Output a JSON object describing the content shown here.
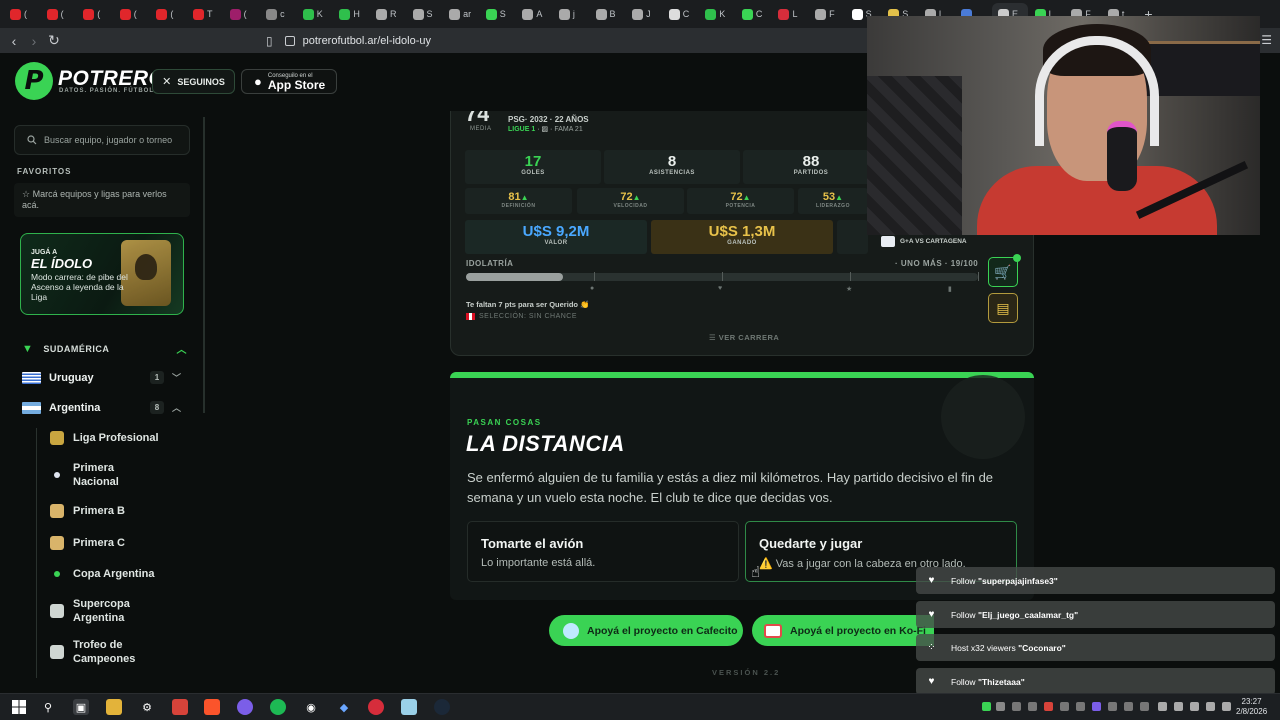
{
  "browser": {
    "tabs": [
      {
        "label": "(",
        "color": "#e0262b"
      },
      {
        "label": "(",
        "color": "#e0262b"
      },
      {
        "label": "(",
        "color": "#e0262b"
      },
      {
        "label": "(",
        "color": "#e0262b"
      },
      {
        "label": "(",
        "color": "#e0262b"
      },
      {
        "label": "T",
        "color": "#e0262b"
      },
      {
        "label": "(",
        "color": "#9e1e6a"
      },
      {
        "label": "c",
        "color": "#888888"
      },
      {
        "label": "K",
        "color": "#2fbf4c"
      },
      {
        "label": "H",
        "color": "#2fbf4c"
      },
      {
        "label": "R",
        "color": "#aaaaaa"
      },
      {
        "label": "S",
        "color": "#aaaaaa"
      },
      {
        "label": "ar",
        "color": "#aaaaaa"
      },
      {
        "label": "S",
        "color": "#3ad354"
      },
      {
        "label": "A",
        "color": "#aaaaaa"
      },
      {
        "label": "j",
        "color": "#aaaaaa"
      },
      {
        "label": "B",
        "color": "#aaaaaa"
      },
      {
        "label": "J",
        "color": "#aaaaaa"
      },
      {
        "label": "C",
        "color": "#dddddd"
      },
      {
        "label": "K",
        "color": "#2fbf4c"
      },
      {
        "label": "C",
        "color": "#3ad354"
      },
      {
        "label": "L",
        "color": "#d62d3b"
      },
      {
        "label": "F",
        "color": "#aaaaaa"
      },
      {
        "label": "S",
        "color": "#ffffff"
      },
      {
        "label": "S",
        "color": "#e3c14a"
      },
      {
        "label": "L",
        "color": "#aaaaaa"
      },
      {
        "label": "",
        "color": "#4a7bd8"
      },
      {
        "label": "E",
        "color": "#cccccc"
      },
      {
        "label": "L",
        "color": "#3ad354"
      },
      {
        "label": "F",
        "color": "#aaaaaa"
      },
      {
        "label": "t",
        "color": "#aaaaaa"
      }
    ],
    "new_tab": "+",
    "url": "potrerofutbol.ar/el-idolo-uy"
  },
  "header": {
    "brand": "POTRERO",
    "tagline": "DATOS. PASIÓN. FÚTBOL.",
    "follow_label": "SEGUINOS",
    "store_small": "Conseguilo en el",
    "store_big": "App Store"
  },
  "sidebar": {
    "search_placeholder": "Buscar equipo, jugador o torneo",
    "favorites_title": "FAVORITOS",
    "favorites_hint": "☆  Marcá equipos y ligas para verlos acá.",
    "promo": {
      "pre": "JUGÁ A",
      "title": "EL ÍDOLO",
      "desc": "Modo carrera: de pibe del Ascenso a leyenda de la Liga"
    },
    "region": "SUDAMÉRICA",
    "countries": [
      {
        "name": "Uruguay",
        "count": "1"
      },
      {
        "name": "Argentina",
        "count": "8"
      }
    ],
    "leagues": [
      {
        "name": "Liga Profesional",
        "color": "#c9a640"
      },
      {
        "name": "Primera Nacional",
        "color": "#dfe5f0"
      },
      {
        "name": "Primera B",
        "color": "#d9b46a"
      },
      {
        "name": "Primera C",
        "color": "#d9b46a"
      },
      {
        "name": "Copa Argentina",
        "color": "#3ad354"
      },
      {
        "name": "Supercopa Argentina",
        "color": "#cfd6d2"
      },
      {
        "name": "Trofeo de Campeones",
        "color": "#cfd6d2"
      }
    ]
  },
  "player": {
    "rating": "74",
    "rating_label": "MEDIA",
    "club_line": "PSG· 2032 · 22 AÑOS",
    "league": "LIGUE 1",
    "fame": "FAMA 21",
    "stats": [
      {
        "value": "17",
        "label": "GOLES",
        "color": "#3ad354"
      },
      {
        "value": "8",
        "label": "ASISTENCIAS",
        "color": "#e9eeeb"
      },
      {
        "value": "88",
        "label": "PARTIDOS",
        "color": "#e9eeeb"
      }
    ],
    "attrs": [
      {
        "value": "81",
        "label": "DEFINICIÓN"
      },
      {
        "value": "72",
        "label": "VELOCIDAD"
      },
      {
        "value": "72",
        "label": "POTENCIA"
      },
      {
        "value": "53",
        "label": "LIDERAZGO"
      }
    ],
    "money": [
      {
        "value": "U$S 9,2M",
        "label": "VALOR"
      },
      {
        "value": "U$S 1,3M",
        "label": "GANADO"
      }
    ],
    "next_match": "G+A VS CARTAGENA",
    "idolatry_label": "IDOLATRÍA",
    "idolatry_status": "· UNO MÁS · 19/100",
    "idolatry_progress": 0.19,
    "faltan": "Te faltan 7 pts para ser Querido 👏",
    "seleccion": "SELECCIÓN: SIN CHANCE",
    "ver_carrera": "☰  VER CARRERA"
  },
  "event": {
    "kicker": "PASAN COSAS",
    "title": "LA DISTANCIA",
    "text": "Se enfermó alguien de tu familia y estás a diez mil kilómetros. Hay partido decisivo el fin de semana y un vuelo esta noche. El club te dice que decidas vos.",
    "options": [
      {
        "title": "Tomarte el avión",
        "desc": "Lo importante está allá."
      },
      {
        "title": "Quedarte y jugar",
        "desc": "⚠️ Vas a jugar con la cabeza en otro lado."
      }
    ]
  },
  "support": {
    "cafecito": "Apoyá el proyecto en Cafecito",
    "kofi": "Apoyá el proyecto en Ko-Fi",
    "version": "VERSIÓN 2.2"
  },
  "alerts": [
    {
      "icon": "heart-icon",
      "glyph": "♥",
      "prefix": "Follow ",
      "name": "\"superpajajinfase3\""
    },
    {
      "icon": "heart-icon",
      "glyph": "♥",
      "prefix": "Follow ",
      "name": "\"Elj_juego_caalamar_tg\""
    },
    {
      "icon": "host-icon",
      "glyph": "⁘",
      "prefix": "Host x32 viewers ",
      "name": "\"Coconaro\""
    },
    {
      "icon": "heart-icon",
      "glyph": "♥",
      "prefix": "Follow ",
      "name": "\"Thizetaaa\""
    }
  ],
  "taskbar": {
    "time": "23:27",
    "date": "2/8/2026"
  },
  "colors": {
    "accent": "#3ad354",
    "background": "#0b0e0d",
    "gold": "#e8c24a"
  }
}
